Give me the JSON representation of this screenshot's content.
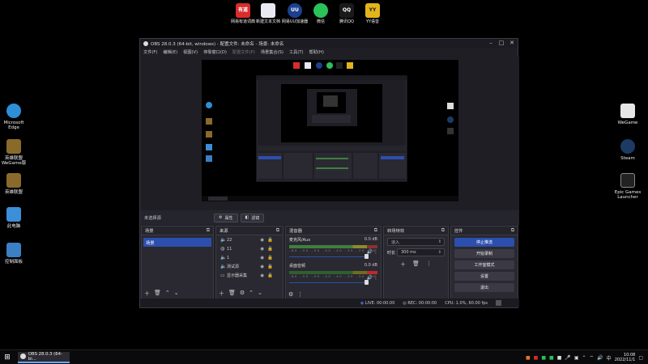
{
  "desktop": {
    "top_icons": [
      {
        "label": "网易有道词典",
        "badge": "有道",
        "color": "#d92c2c"
      },
      {
        "label": "新建文本文档",
        "badge": "",
        "color": "#e9e9f4"
      },
      {
        "label": "网易UU加速器",
        "badge": "UU",
        "color": "#1c3f8f"
      },
      {
        "label": "微信",
        "badge": "",
        "color": "#2bc25a"
      },
      {
        "label": "腾讯QQ",
        "badge": "QQ",
        "color": "#1a1a1a"
      },
      {
        "label": "YY语音",
        "badge": "YY",
        "color": "#e3b51a"
      }
    ],
    "left_icons": [
      {
        "label": "Microsoft Edge",
        "color": "#2d8fd6"
      },
      {
        "label": "英雄联盟 WeGame版",
        "color": "#8a6a2a"
      },
      {
        "label": "英雄联盟",
        "color": "#8a6a2a"
      },
      {
        "label": "此电脑",
        "color": "#3c8ed8"
      },
      {
        "label": "控制面板",
        "color": "#3b7fc4"
      }
    ],
    "right_icons": [
      {
        "label": "WeGame",
        "color": "#e6e6e6"
      },
      {
        "label": "Steam",
        "color": "#1b3b65"
      },
      {
        "label": "Epic Games Launcher",
        "color": "#222222"
      }
    ]
  },
  "obs": {
    "title": "OBS 28.0.3 (64-bit, windows) - 配置文件: 未命名 - 场景: 未命名",
    "menu": [
      "文件(F)",
      "编辑(E)",
      "视图(V)",
      "停靠窗口(D)",
      "配置文件(P)",
      "场景集合(S)",
      "工具(T)",
      "帮助(H)"
    ],
    "scene_bar": {
      "scene_name": "未选择源",
      "properties": "属性",
      "filters": "滤镜"
    },
    "docks": {
      "scenes": {
        "title": "场景",
        "items": [
          "场景"
        ]
      },
      "sources": {
        "title": "来源",
        "items": [
          {
            "name": "22",
            "icon": "speaker"
          },
          {
            "name": "11",
            "icon": "globe"
          },
          {
            "name": "1",
            "icon": "speaker"
          },
          {
            "name": "测试源",
            "icon": "speaker"
          },
          {
            "name": "显示器采集",
            "icon": "monitor"
          }
        ]
      },
      "mixer": {
        "title": "混音器",
        "tracks": [
          {
            "name": "麦克风/Aux",
            "db": "0.0 dB"
          },
          {
            "name": "桌面音频",
            "db": "0.0 dB"
          }
        ],
        "scale": "-60 -55 -50 -45 -40 -35 -30 -25 -20 -15 -10 -5 0"
      },
      "transitions": {
        "title": "转场特效",
        "type": "淡入",
        "duration_label": "时长",
        "duration": "300 ms"
      },
      "controls": {
        "title": "控件",
        "buttons": [
          "停止推流",
          "开始录制",
          "工作室模式",
          "设置",
          "退出"
        ]
      }
    },
    "status": {
      "live": "LIVE: 00:00:00",
      "rec": "REC: 00:00:00",
      "cpu": "CPU: 1.0%, 60.00 fps"
    }
  },
  "taskbar": {
    "app": "OBS 28.0.3 (64-bi...",
    "time": "10:08",
    "date": "2022/11/1"
  },
  "colors": {
    "accent": "#2c4fad",
    "bg": "#1f1e24",
    "dock": "#2a2931"
  }
}
